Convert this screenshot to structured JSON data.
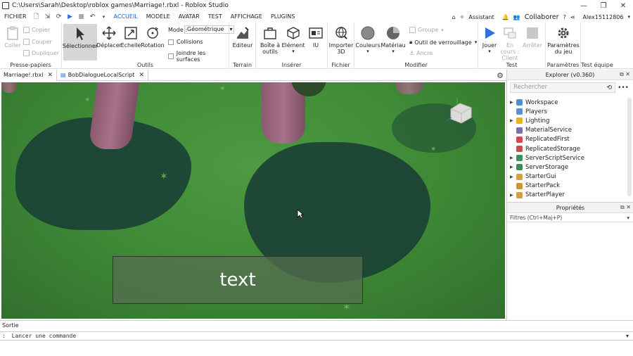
{
  "window": {
    "title": "C:\\Users\\Sarah\\Desktop\\roblox games\\Marriage!.rbxl - Roblox Studio"
  },
  "menu": {
    "file": "FICHIER",
    "tabs": [
      "ACCUEIL",
      "MODELE",
      "AVATAR",
      "TEST",
      "AFFICHAGE",
      "PLUGINS"
    ],
    "assistant": "Assistant",
    "collaborate": "Collaborer",
    "user": "Alex15112806"
  },
  "ribbon": {
    "clipboard": {
      "label": "Presse-papiers",
      "paste": "Coller",
      "copy": "Copier",
      "cut": "Couper",
      "duplicate": "Dupliquer"
    },
    "tools": {
      "label": "Outils",
      "select": "Sélectionner",
      "move": "Déplacer",
      "scale": "Echelle",
      "rotate": "Rotation",
      "mode_label": "Mode :",
      "mode_value": "Géométrique",
      "collisions": "Collisions",
      "join_surfaces": "Joindre les surfaces"
    },
    "terrain": {
      "label": "Terrain",
      "editor": "Editeur"
    },
    "insert": {
      "label": "Insérer",
      "toolbox": "Boîte à outils",
      "part": "Elément",
      "ui": "IU"
    },
    "file": {
      "label": "Fichier",
      "import3d": "Importer 3D"
    },
    "modify": {
      "label": "Modifier",
      "colors": "Couleurs",
      "material": "Matériau",
      "group": "Groupe",
      "lock_tool": "Outil de verrouillage",
      "anchor": "Ancre"
    },
    "test": {
      "label": "Test",
      "play": "Jouer",
      "client": "En cours : Client",
      "stop": "Arrêter"
    },
    "settings": {
      "label": "Paramètres",
      "game_settings": "Paramètres du jeu"
    },
    "team_test": {
      "label": "Test équipe"
    }
  },
  "doc_tabs": [
    {
      "label": "Marriage!.rbxl"
    },
    {
      "label": "BobDialogueLocalScript"
    }
  ],
  "viewport": {
    "textbox_text": "text"
  },
  "explorer": {
    "title": "Explorer (v0.360)",
    "search_placeholder": "Rechercher",
    "items": [
      {
        "label": "Workspace",
        "icon_color": "#4a90d9",
        "expandable": true
      },
      {
        "label": "Players",
        "icon_color": "#5a8fd6",
        "expandable": false
      },
      {
        "label": "Lighting",
        "icon_color": "#e5b420",
        "expandable": true
      },
      {
        "label": "MaterialService",
        "icon_color": "#7b6fb0",
        "expandable": false
      },
      {
        "label": "ReplicatedFirst",
        "icon_color": "#d14a4a",
        "expandable": false
      },
      {
        "label": "ReplicatedStorage",
        "icon_color": "#c94c4c",
        "expandable": false
      },
      {
        "label": "ServerScriptService",
        "icon_color": "#3f8f5a",
        "expandable": true
      },
      {
        "label": "ServerStorage",
        "icon_color": "#3a8c5c",
        "expandable": true
      },
      {
        "label": "StarterGui",
        "icon_color": "#d6a23c",
        "expandable": true
      },
      {
        "label": "StarterPack",
        "icon_color": "#c9973a",
        "expandable": false
      },
      {
        "label": "StarterPlayer",
        "icon_color": "#d39c3e",
        "expandable": true
      }
    ]
  },
  "properties": {
    "title": "Propriétés",
    "filter_placeholder": "Filtres (Ctrl+Maj+P)"
  },
  "output": {
    "tab": "Sortie",
    "command_placeholder": "Lancer une commande"
  },
  "colors": {
    "accent": "#1463d6",
    "play": "#2f6fe0"
  }
}
